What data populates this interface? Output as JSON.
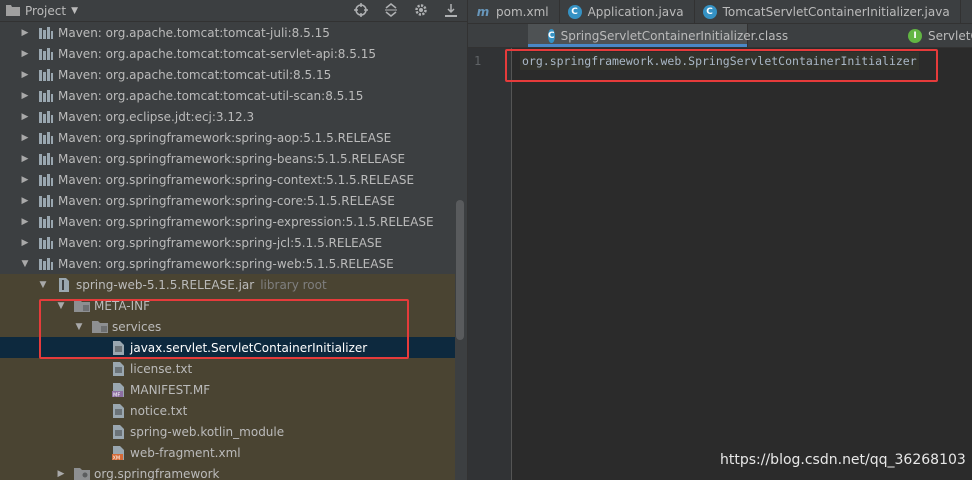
{
  "project_panel": {
    "title": "Project",
    "tools": [
      "target-icon",
      "collapse-icon",
      "gear-icon",
      "hide-icon"
    ]
  },
  "tree": [
    {
      "label": "Maven: org.apache.tomcat:tomcat-juli:8.5.15",
      "icon": "library-icon",
      "expanded": false
    },
    {
      "label": "Maven: org.apache.tomcat:tomcat-servlet-api:8.5.15",
      "icon": "library-icon",
      "expanded": false
    },
    {
      "label": "Maven: org.apache.tomcat:tomcat-util:8.5.15",
      "icon": "library-icon",
      "expanded": false
    },
    {
      "label": "Maven: org.apache.tomcat:tomcat-util-scan:8.5.15",
      "icon": "library-icon",
      "expanded": false
    },
    {
      "label": "Maven: org.eclipse.jdt:ecj:3.12.3",
      "icon": "library-icon",
      "expanded": false
    },
    {
      "label": "Maven: org.springframework:spring-aop:5.1.5.RELEASE",
      "icon": "library-icon",
      "expanded": false
    },
    {
      "label": "Maven: org.springframework:spring-beans:5.1.5.RELEASE",
      "icon": "library-icon",
      "expanded": false
    },
    {
      "label": "Maven: org.springframework:spring-context:5.1.5.RELEASE",
      "icon": "library-icon",
      "expanded": false
    },
    {
      "label": "Maven: org.springframework:spring-core:5.1.5.RELEASE",
      "icon": "library-icon",
      "expanded": false
    },
    {
      "label": "Maven: org.springframework:spring-expression:5.1.5.RELEASE",
      "icon": "library-icon",
      "expanded": false
    },
    {
      "label": "Maven: org.springframework:spring-jcl:5.1.5.RELEASE",
      "icon": "library-icon",
      "expanded": false
    },
    {
      "label": "Maven: org.springframework:spring-web:5.1.5.RELEASE",
      "icon": "library-icon",
      "expanded": true
    },
    {
      "label": "spring-web-5.1.5.RELEASE.jar",
      "hint": "library root",
      "icon": "jar-icon",
      "expanded": true
    },
    {
      "label": "META-INF",
      "icon": "folder-icon",
      "expanded": true
    },
    {
      "label": "services",
      "icon": "folder-icon",
      "expanded": true
    },
    {
      "label": "javax.servlet.ServletContainerInitializer",
      "icon": "text-file-icon",
      "selected": true
    },
    {
      "label": "license.txt",
      "icon": "text-file-icon"
    },
    {
      "label": "MANIFEST.MF",
      "icon": "manifest-file-icon"
    },
    {
      "label": "notice.txt",
      "icon": "text-file-icon"
    },
    {
      "label": "spring-web.kotlin_module",
      "icon": "text-file-icon"
    },
    {
      "label": "web-fragment.xml",
      "icon": "xml-file-icon"
    },
    {
      "label": "org.springframework",
      "icon": "package-icon",
      "expanded": false
    }
  ],
  "editor": {
    "tabs_row1": [
      {
        "label": "pom.xml",
        "icon": "maven-icon"
      },
      {
        "label": "Application.java",
        "icon": "class-icon"
      },
      {
        "label": "TomcatServletContainerInitializer.java",
        "icon": "class-icon"
      }
    ],
    "tabs_row2": [
      {
        "label": "SpringServletContainerInitializer.class",
        "icon": "class-icon"
      },
      {
        "label": "ServletCo",
        "icon": "interface-icon"
      }
    ],
    "line_number": "1",
    "code": "org.springframework.web.SpringServletContainerInitializer"
  },
  "watermark": "https://blog.csdn.net/qq_36268103",
  "colors": {
    "callout": "#e63b3b",
    "selection": "#0d293e",
    "library_zone": "#4a4432",
    "tab_accent": "#4a88c7"
  }
}
